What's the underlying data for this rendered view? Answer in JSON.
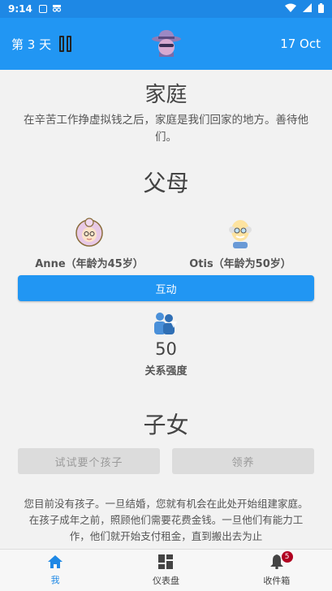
{
  "statusbar": {
    "time": "9:14"
  },
  "appbar": {
    "day_label": "第 3 天",
    "date": "17 Oct"
  },
  "family": {
    "title": "家庭",
    "description": "在辛苦工作挣虚拟钱之后，家庭是我们回家的地方。善待他们。"
  },
  "parents": {
    "title": "父母",
    "mother": "Anne（年龄为45岁）",
    "father": "Otis（年龄为50岁）",
    "interact_label": "互动",
    "relationship_value": "50",
    "relationship_label": "关系强度"
  },
  "children": {
    "title": "子女",
    "try_label": "试试要个孩子",
    "adopt_label": "领养",
    "description": "您目前没有孩子。一旦结婚，您就有机会在此处开始组建家庭。在孩子成年之前，照顾他们需要花费金钱。一旦他们有能力工作，他们就开始支付租金，直到搬出去为止"
  },
  "bottomnav": {
    "me": "我",
    "dashboard": "仪表盘",
    "inbox": "收件箱",
    "inbox_badge": "5"
  },
  "colors": {
    "primary": "#2196f3",
    "badge": "#b00020",
    "disabled": "#dcdcdc"
  }
}
